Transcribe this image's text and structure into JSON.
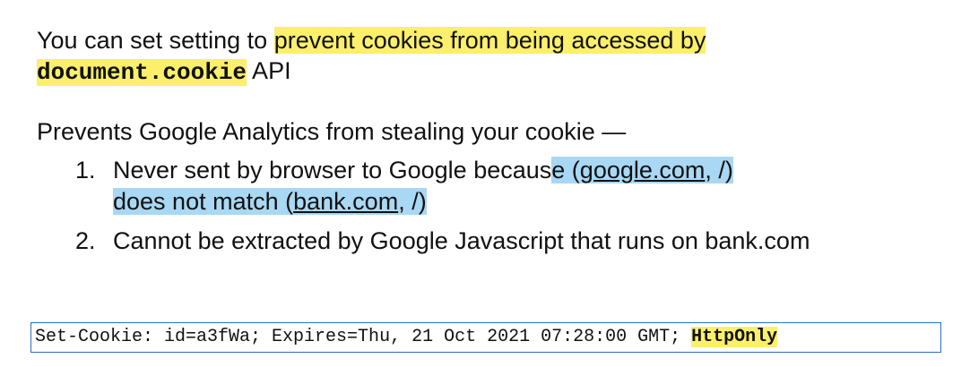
{
  "intro": {
    "prefix": "You can set setting to ",
    "highlight": "prevent cookies from being accessed by ",
    "code": "document.cookie",
    "suffix": " API"
  },
  "prevents": {
    "heading": "Prevents Google Analytics from stealing your cookie —",
    "items": [
      {
        "number": "1.",
        "text_before": "Never sent by browser to Google becaus",
        "hl_start": "e ",
        "link1": "google.com",
        "link1_rest": ", /)",
        "paren1": "(",
        "line2_pre": "does not match ",
        "paren2": "(",
        "link2": "bank.com",
        "link2_rest": ", /)"
      },
      {
        "number": "2.",
        "text": "Cannot be extracted by Google Javascript that runs on bank.com"
      }
    ]
  },
  "header_line": {
    "text": "Set-Cookie: id=a3fWa; Expires=Thu, 21 Oct 2021 07:28:00 GMT; ",
    "flag": "HttpOnly"
  },
  "colors": {
    "yellow_highlight": "#fbef6c",
    "blue_highlight": "#a8d8f3",
    "box_border": "#2e6fb7"
  }
}
